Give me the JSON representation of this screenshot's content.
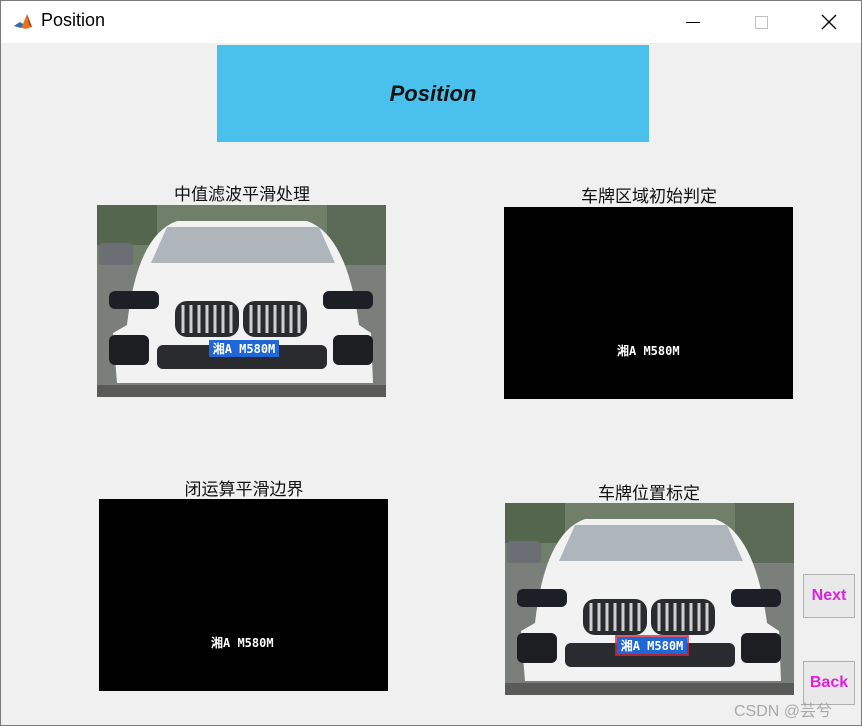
{
  "window": {
    "title": "Position"
  },
  "banner": {
    "title": "Position"
  },
  "panels": {
    "median_filter": {
      "caption": "中值滤波平滑处理",
      "plate_text": "湘A M580M"
    },
    "initial_region": {
      "caption": "车牌区域初始判定",
      "plate_text": "湘A M580M"
    },
    "closing": {
      "caption": "闭运算平滑边界",
      "plate_text": "湘A M580M"
    },
    "plate_location": {
      "caption": "车牌位置标定",
      "plate_text": "湘A M580M"
    }
  },
  "buttons": {
    "next_label": "Next",
    "back_label": "Back"
  },
  "watermark": {
    "text": "CSDN @芸兮"
  },
  "colors": {
    "banner": "#4ac0ec",
    "button_text": "#e21fe0",
    "plate_blue": "#1f67d6",
    "plate_box": "#d8263a"
  }
}
